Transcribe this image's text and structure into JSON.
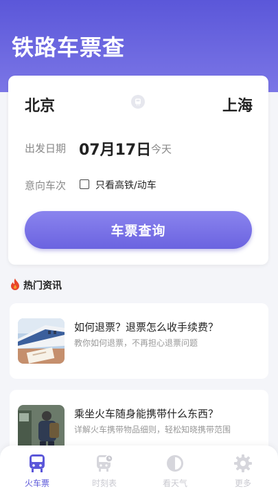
{
  "header": {
    "title": "铁路车票查"
  },
  "search_card": {
    "from_city": "北京",
    "to_city": "上海",
    "date_label": "出发日期",
    "date_value": "07月17日",
    "date_hint": "今天",
    "train_label": "意向车次",
    "high_speed_only_label": "只看高铁/动车",
    "high_speed_only_checked": false,
    "search_button": "车票查询"
  },
  "news_section": {
    "title": "热门资讯",
    "items": [
      {
        "title": "如何退票？退票怎么收手续费？",
        "subtitle": "教你如何退票，不再担心退票问题",
        "image": "high-speed-train-ticket-photo"
      },
      {
        "title": "乘坐火车随身能携带什么东西？",
        "subtitle": "详解火车携带物品细则，轻松知晓携带范围",
        "image": "traveler-with-backpack-photo"
      }
    ]
  },
  "tabbar": {
    "tabs": [
      {
        "label": "火车票",
        "icon": "train-icon",
        "active": true
      },
      {
        "label": "时刻表",
        "icon": "schedule-icon",
        "active": false
      },
      {
        "label": "看天气",
        "icon": "weather-icon",
        "active": false
      },
      {
        "label": "更多",
        "icon": "gear-icon",
        "active": false
      }
    ]
  },
  "colors": {
    "primary": "#5b57d9",
    "inactive_tab": "#c9c9d0",
    "flame": "#e8452c"
  }
}
